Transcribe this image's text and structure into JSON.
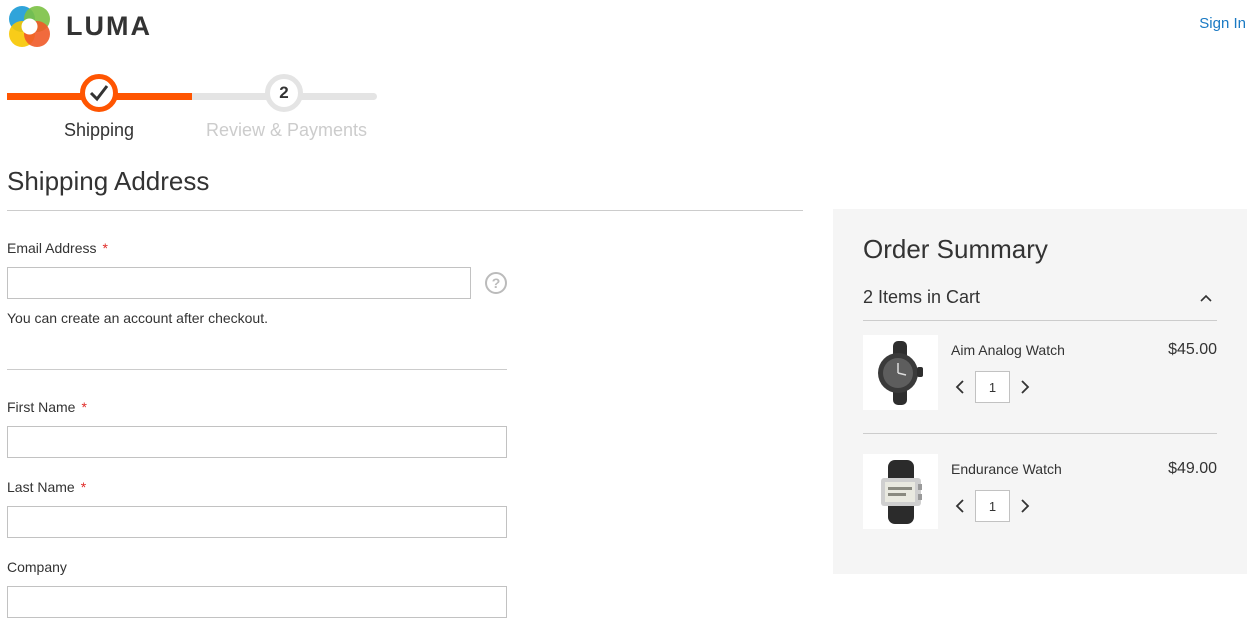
{
  "header": {
    "logo_icon": "luma-logo-icon",
    "logo_text": "LUMA",
    "sign_in": "Sign In"
  },
  "progress": {
    "steps": [
      {
        "label": "Shipping",
        "marker": "check-icon",
        "state": "active"
      },
      {
        "label": "Review & Payments",
        "marker": "2",
        "state": "pending"
      }
    ]
  },
  "shipping": {
    "title": "Shipping Address",
    "required_marker": "*",
    "email": {
      "label": "Email Address",
      "value": "",
      "help_icon": "question-circle-icon"
    },
    "account_note": "You can create an account after checkout.",
    "first_name": {
      "label": "First Name",
      "value": ""
    },
    "last_name": {
      "label": "Last Name",
      "value": ""
    },
    "company": {
      "label": "Company",
      "value": ""
    }
  },
  "summary": {
    "title": "Order Summary",
    "items_count_label": "2 Items in Cart",
    "toggle_icon": "chevron-up-icon",
    "items": [
      {
        "name": "Aim Analog Watch",
        "price": "$45.00",
        "qty": "1"
      },
      {
        "name": "Endurance Watch",
        "price": "$49.00",
        "qty": "1"
      }
    ]
  },
  "colors": {
    "accent": "#ff5501",
    "link": "#1979c3",
    "required": "#e02b27",
    "summary_bg": "#f5f5f5"
  }
}
